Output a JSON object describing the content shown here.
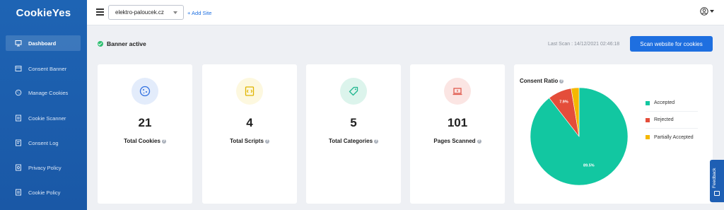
{
  "brand": {
    "name": "CookieYes"
  },
  "sidebar": {
    "items": [
      {
        "label": "Dashboard",
        "icon": "monitor-icon",
        "active": true
      },
      {
        "label": "Consent Banner",
        "icon": "banner-icon"
      },
      {
        "label": "Manage Cookies",
        "icon": "cookie-icon"
      },
      {
        "label": "Cookie Scanner",
        "icon": "scanner-icon"
      },
      {
        "label": "Consent Log",
        "icon": "log-icon"
      },
      {
        "label": "Privacy Policy",
        "icon": "shield-icon"
      },
      {
        "label": "Cookie Policy",
        "icon": "document-icon"
      }
    ]
  },
  "topbar": {
    "site_value": "elektro-paloucek.cz",
    "add_site_label": "+ Add Site"
  },
  "status": {
    "banner_label": "Banner active"
  },
  "scan": {
    "last_scan_label": "Last Scan : 14/12/2021 02:46:18",
    "button_label": "Scan website for cookies"
  },
  "cards": [
    {
      "value": "21",
      "label": "Total Cookies",
      "icon": "cookie-icon",
      "color": "#2f6fe0",
      "bg": "#e3ecfb"
    },
    {
      "value": "4",
      "label": "Total Scripts",
      "icon": "script-icon",
      "color": "#e0b400",
      "bg": "#fdf8df"
    },
    {
      "value": "5",
      "label": "Total Categories",
      "icon": "tag-icon",
      "color": "#1fb68f",
      "bg": "#dcf4ec"
    },
    {
      "value": "101",
      "label": "Pages Scanned",
      "icon": "laptop-icon",
      "color": "#e05a4e",
      "bg": "#fbe5e3"
    }
  ],
  "consent": {
    "title": "Consent Ratio",
    "chart_data": {
      "type": "pie",
      "categories": [
        "Accepted",
        "Rejected",
        "Partially Accepted"
      ],
      "values": [
        89.5,
        7.9,
        2.6
      ],
      "data_labels": [
        "89.5%",
        "7.9%",
        ""
      ],
      "colors": [
        "#12c7a1",
        "#e44d3a",
        "#f5b800"
      ],
      "legend_position": "right"
    }
  },
  "feedback": {
    "label": "Feedback"
  }
}
